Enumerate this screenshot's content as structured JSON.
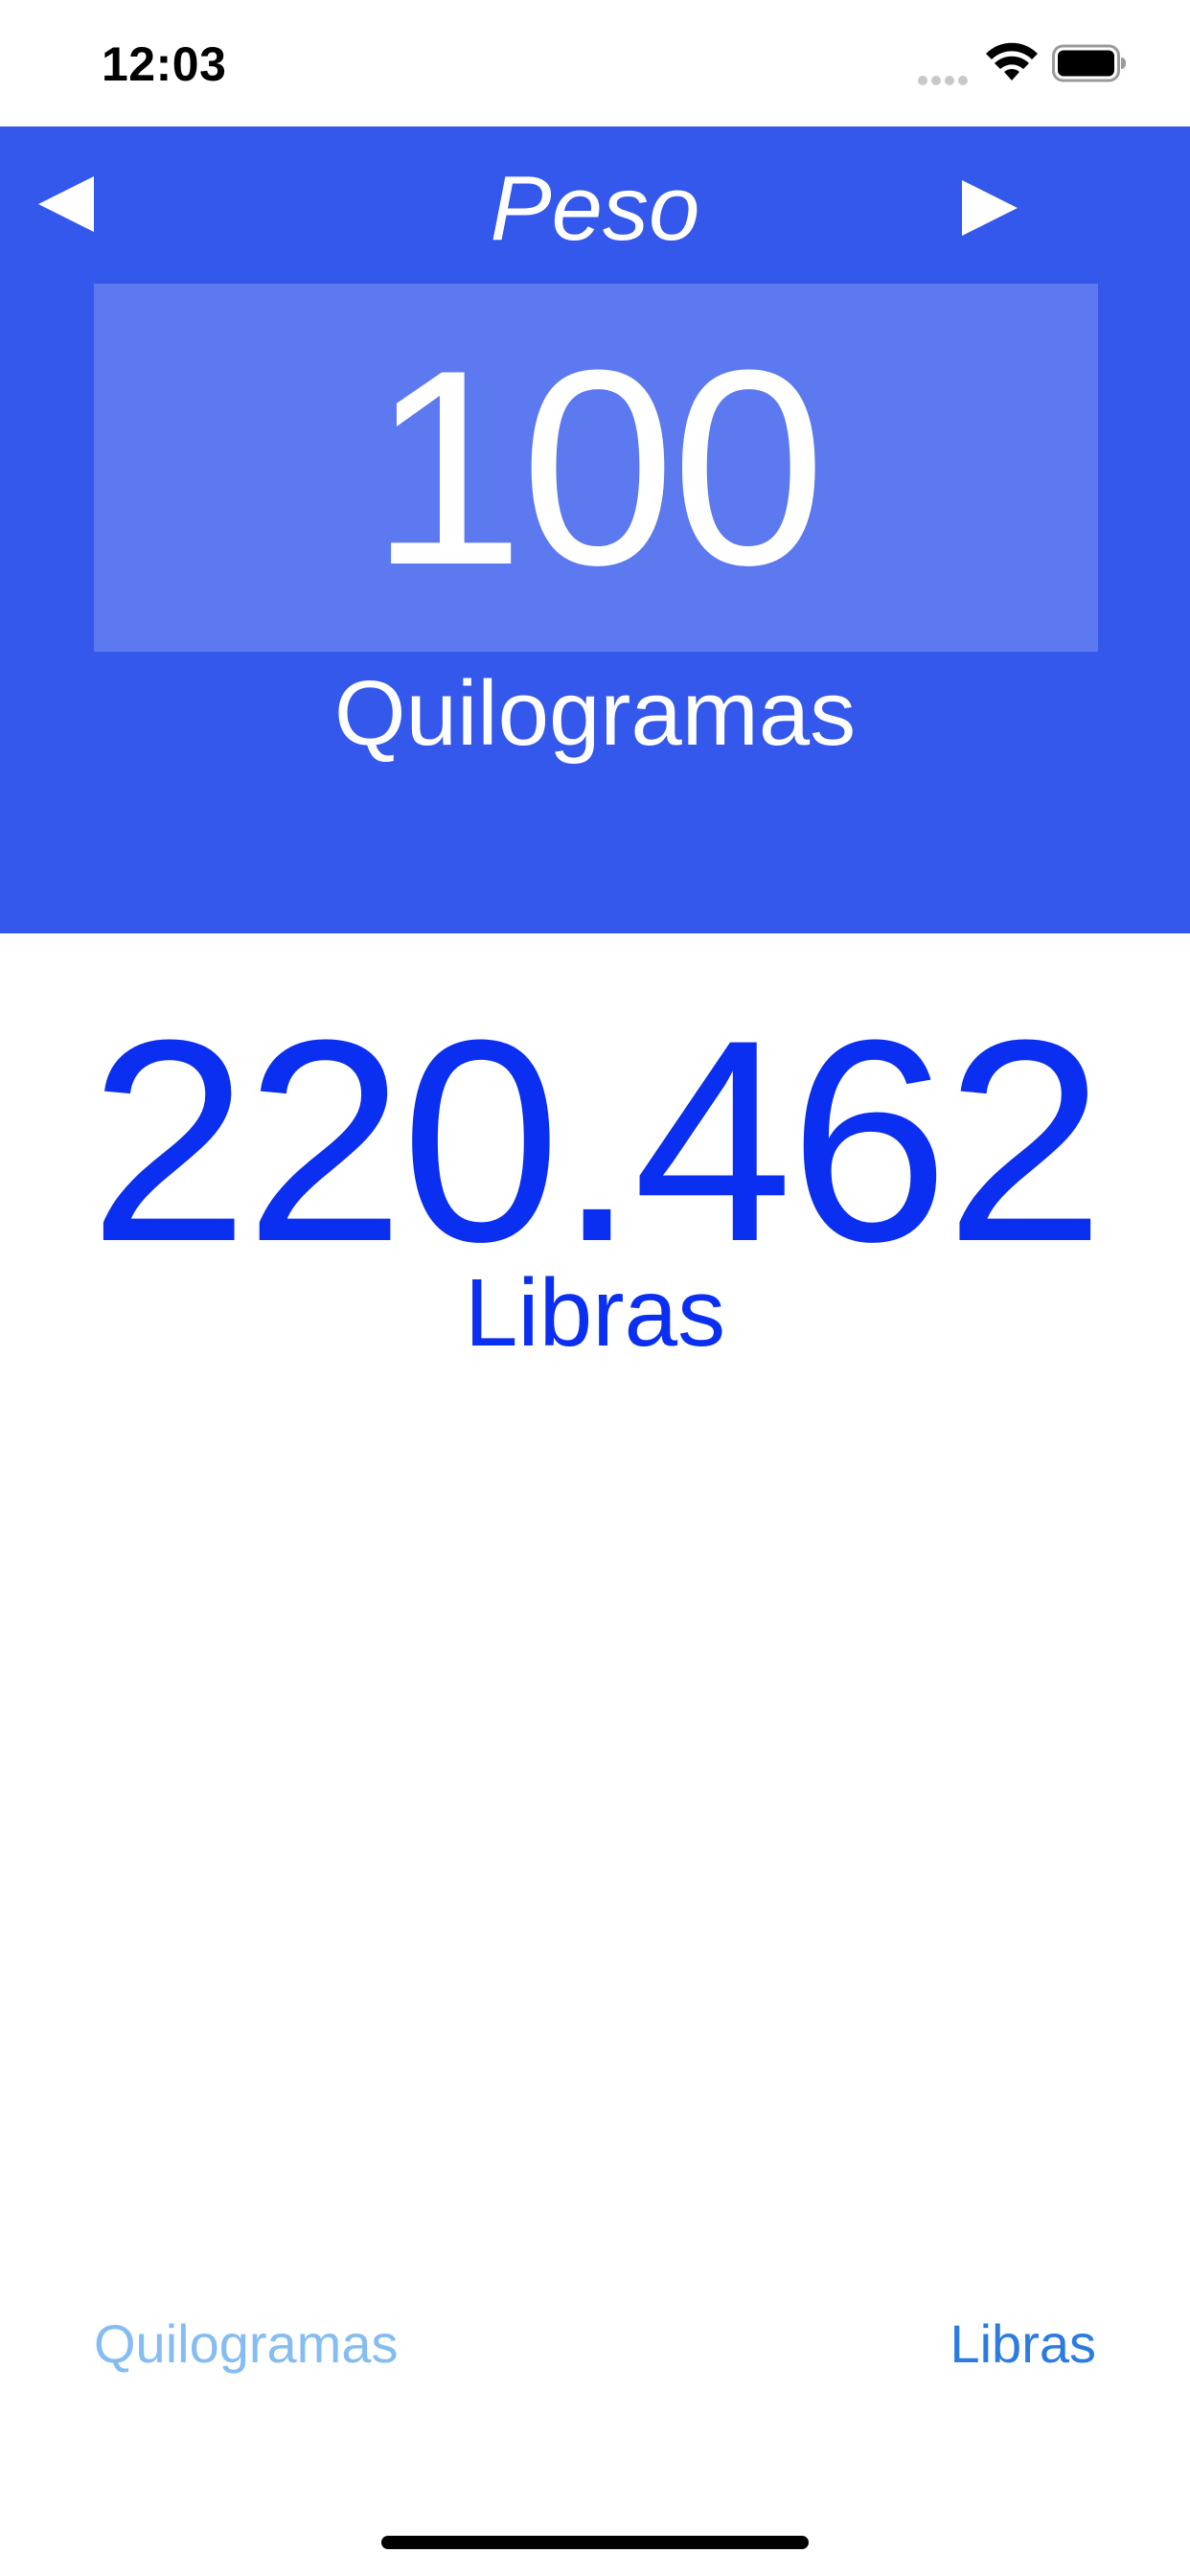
{
  "status_bar": {
    "time": "12:03"
  },
  "header": {
    "category_title": "Peso",
    "prev_icon": "triangle-left-icon",
    "next_icon": "triangle-right-icon"
  },
  "input": {
    "value": "100",
    "unit_label": "Quilogramas"
  },
  "result": {
    "value": "220.462",
    "unit_label": "Libras"
  },
  "unit_selector": {
    "from_label": "Quilogramas",
    "to_label": "Libras"
  },
  "colors": {
    "header_background": "#3458eb",
    "result_text": "#0a2ff0",
    "from_option_text": "#85bdf2",
    "to_option_text": "#2c7ce0"
  }
}
